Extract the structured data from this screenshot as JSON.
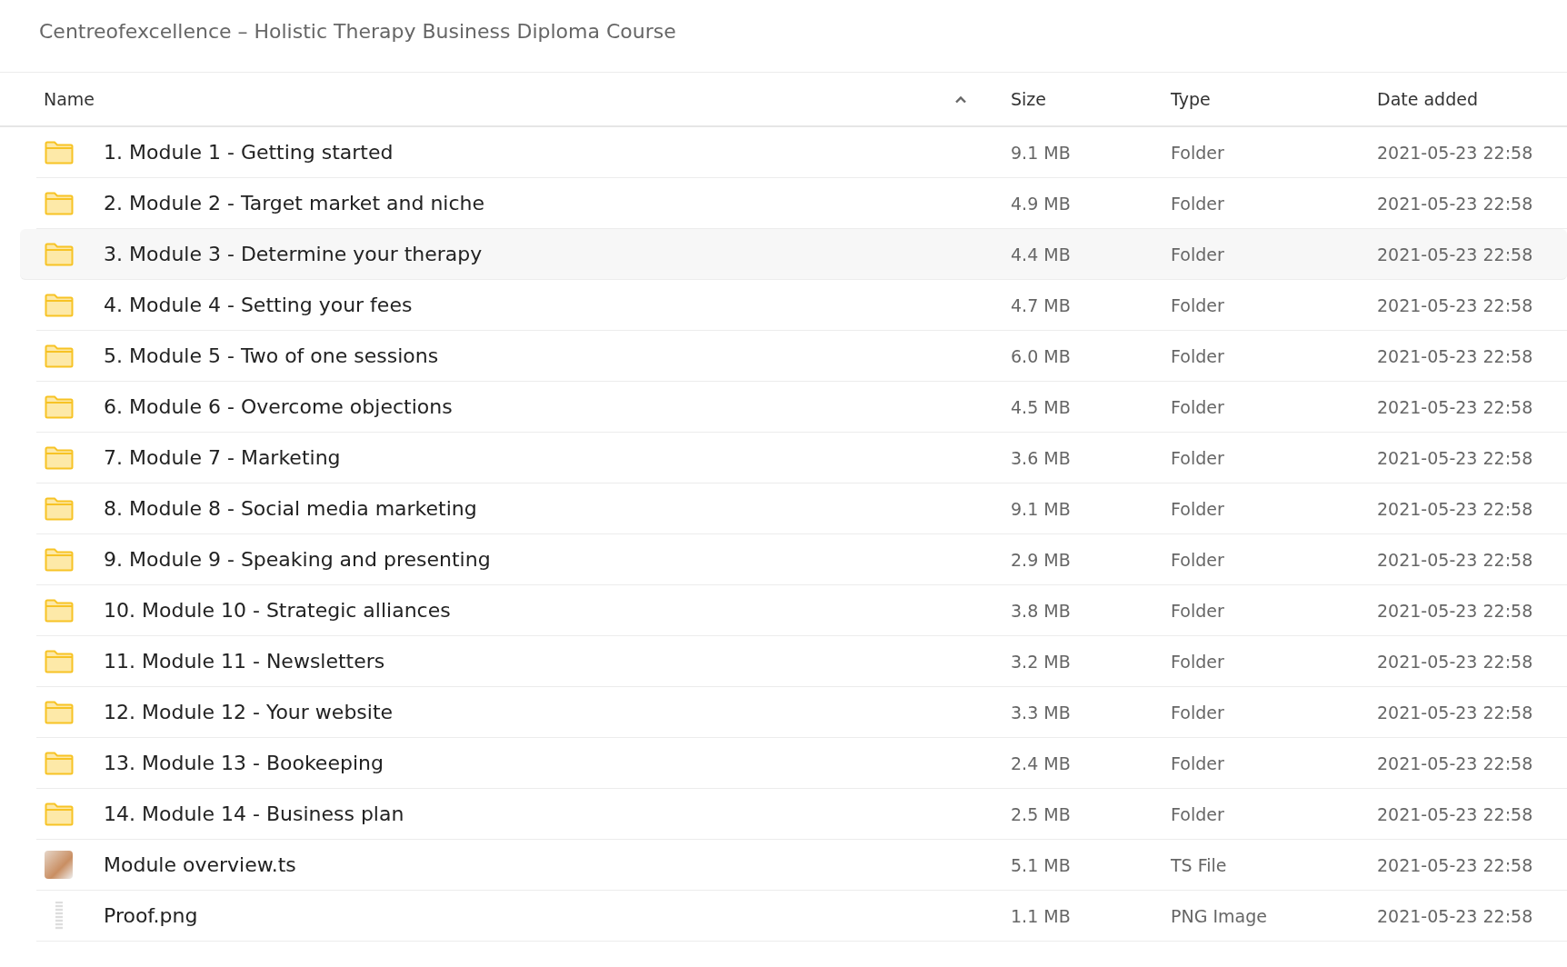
{
  "title": "Centreofexcellence – Holistic Therapy Business Diploma Course",
  "columns": [
    {
      "label": "Name",
      "sorted": true
    },
    {
      "label": "Size",
      "sorted": false
    },
    {
      "label": "Type",
      "sorted": false
    },
    {
      "label": "Date added",
      "sorted": false
    }
  ],
  "rows": [
    {
      "kind": "folder",
      "name": "1. Module 1 - Getting started",
      "size": "9.1 MB",
      "type": "Folder",
      "date": "2021-05-23 22:58",
      "highlighted": false
    },
    {
      "kind": "folder",
      "name": "2. Module 2 - Target market and niche",
      "size": "4.9 MB",
      "type": "Folder",
      "date": "2021-05-23 22:58",
      "highlighted": false
    },
    {
      "kind": "folder",
      "name": "3. Module 3 - Determine your therapy",
      "size": "4.4 MB",
      "type": "Folder",
      "date": "2021-05-23 22:58",
      "highlighted": true
    },
    {
      "kind": "folder",
      "name": "4. Module 4 - Setting your fees",
      "size": "4.7 MB",
      "type": "Folder",
      "date": "2021-05-23 22:58",
      "highlighted": false
    },
    {
      "kind": "folder",
      "name": "5. Module 5 - Two of one sessions",
      "size": "6.0 MB",
      "type": "Folder",
      "date": "2021-05-23 22:58",
      "highlighted": false
    },
    {
      "kind": "folder",
      "name": "6. Module 6 - Overcome objections",
      "size": "4.5 MB",
      "type": "Folder",
      "date": "2021-05-23 22:58",
      "highlighted": false
    },
    {
      "kind": "folder",
      "name": "7. Module 7 - Marketing",
      "size": "3.6 MB",
      "type": "Folder",
      "date": "2021-05-23 22:58",
      "highlighted": false
    },
    {
      "kind": "folder",
      "name": "8. Module 8 - Social media marketing",
      "size": "9.1 MB",
      "type": "Folder",
      "date": "2021-05-23 22:58",
      "highlighted": false
    },
    {
      "kind": "folder",
      "name": "9. Module 9 - Speaking and presenting",
      "size": "2.9 MB",
      "type": "Folder",
      "date": "2021-05-23 22:58",
      "highlighted": false
    },
    {
      "kind": "folder",
      "name": "10. Module 10 - Strategic alliances",
      "size": "3.8 MB",
      "type": "Folder",
      "date": "2021-05-23 22:58",
      "highlighted": false
    },
    {
      "kind": "folder",
      "name": "11. Module 11 - Newsletters",
      "size": "3.2 MB",
      "type": "Folder",
      "date": "2021-05-23 22:58",
      "highlighted": false
    },
    {
      "kind": "folder",
      "name": "12. Module 12 - Your website",
      "size": "3.3 MB",
      "type": "Folder",
      "date": "2021-05-23 22:58",
      "highlighted": false
    },
    {
      "kind": "folder",
      "name": "13. Module 13 - Bookeeping",
      "size": "2.4 MB",
      "type": "Folder",
      "date": "2021-05-23 22:58",
      "highlighted": false
    },
    {
      "kind": "folder",
      "name": "14. Module 14 - Business plan",
      "size": "2.5 MB",
      "type": "Folder",
      "date": "2021-05-23 22:58",
      "highlighted": false
    },
    {
      "kind": "video",
      "name": "Module overview.ts",
      "size": "5.1 MB",
      "type": "TS File",
      "date": "2021-05-23 22:58",
      "highlighted": false
    },
    {
      "kind": "image",
      "name": "Proof.png",
      "size": "1.1 MB",
      "type": "PNG Image",
      "date": "2021-05-23 22:58",
      "highlighted": false
    }
  ]
}
